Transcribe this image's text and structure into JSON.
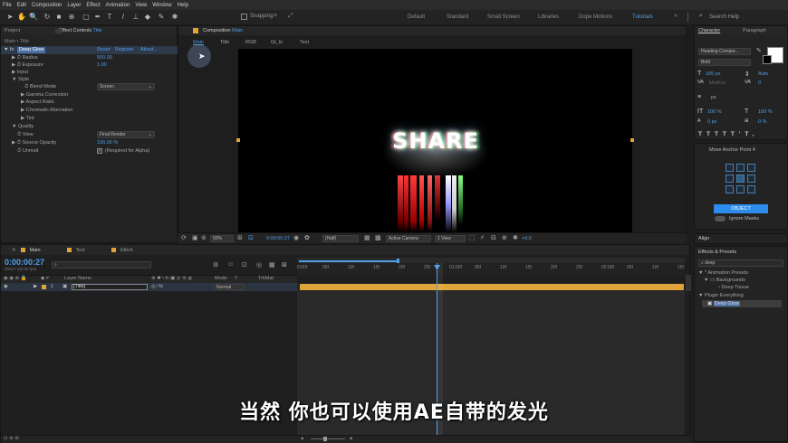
{
  "menu": [
    "File",
    "Edit",
    "Composition",
    "Layer",
    "Effect",
    "Animation",
    "View",
    "Window",
    "Help"
  ],
  "toolbar": {
    "snapping_label": "Snapping"
  },
  "workspaces": [
    "Default",
    "Standard",
    "Small Screen",
    "Libraries",
    "Dope Motions",
    "Tutorials"
  ],
  "active_workspace": "Tutorials",
  "search_help": "Search Help",
  "project_tab": "Project",
  "effect_controls": {
    "tab": "Effect Controls",
    "tab_layer": "Title",
    "breadcrumb": "Main • Title",
    "effect_name": "Deep Glow",
    "reset": "Reset",
    "register": "Register",
    "about": "About...",
    "props": [
      {
        "label": "Radius",
        "value": "500.00"
      },
      {
        "label": "Exposure",
        "value": "1.00"
      },
      {
        "label": "Input",
        "value": ""
      },
      {
        "label": "Style",
        "value": ""
      },
      {
        "label": "Blend Mode",
        "value": "Screen"
      },
      {
        "label": "Gamma Correction",
        "value": ""
      },
      {
        "label": "Aspect Ratio",
        "value": ""
      },
      {
        "label": "Chromatic Aberration",
        "value": ""
      },
      {
        "label": "Tint",
        "value": ""
      },
      {
        "label": "Quality",
        "value": ""
      },
      {
        "label": "View",
        "value": "Final Render"
      },
      {
        "label": "Source Opacity",
        "value": "100.00 %"
      },
      {
        "label": "Unmult",
        "value": "(Required for Alpha)"
      }
    ]
  },
  "composition": {
    "tab": "Composition",
    "tab_name": "Main",
    "nav": [
      "Main",
      "Title",
      "RGB",
      "Gl_In",
      "Text"
    ],
    "glow_text": "SHARE"
  },
  "viewer_controls": {
    "zoom": "50%",
    "timecode": "0:00:00:27",
    "resolution": "(Half)",
    "camera": "Active Camera",
    "view": "1 View",
    "exposure": "+0.0"
  },
  "timeline": {
    "tabs": [
      "Main",
      "Text",
      "Glitch"
    ],
    "timecode": "0:00:00:27",
    "fps": "00027 (30.00 fps)",
    "search_placeholder": "",
    "col_layer": "Layer Name",
    "col_mode": "Mode",
    "col_trkmat": "TrkMat",
    "layer_num": "1",
    "layer_name": "[Title]",
    "layer_mode": "Normal",
    "ruler": [
      "0:00f",
      "05f",
      "10f",
      "15f",
      "20f",
      "25f",
      "01:00f",
      "05f",
      "10f",
      "15f",
      "20f",
      "25f",
      "02:00f",
      "05f",
      "10f",
      "15f"
    ]
  },
  "character": {
    "tab": "Character",
    "tab2": "Paragraph",
    "font": "Heading Compre...",
    "style": "Bold",
    "size": "165 px",
    "leading": "Auto",
    "kerning": "Metrics",
    "tracking": "0",
    "stroke": "px",
    "vscale": "100 %",
    "hscale": "100 %",
    "baseline": "0 px",
    "tsume": "0 %"
  },
  "move_anchor": {
    "title": "Move Anchor Point 4",
    "object_btn": "OBJECT",
    "ignore_masks": "Ignore Masks"
  },
  "align_title": "Align",
  "effects_presets": {
    "title": "Effects & Presets",
    "search": "deep",
    "tree": [
      {
        "label": "* Animation Presets",
        "indent": 0
      },
      {
        "label": "Backgrounds",
        "indent": 1
      },
      {
        "label": "Deep Tissue",
        "indent": 2
      },
      {
        "label": "Plugin Everything",
        "indent": 0
      },
      {
        "label": "Deep Glow",
        "indent": 1
      }
    ]
  },
  "subtitle": "当然 你也可以使用AE自带的发光",
  "colors": {
    "accent": "#2d8ceb",
    "timeline_bar": "#e0a43a",
    "selected_tab": "#4f9fe8"
  }
}
